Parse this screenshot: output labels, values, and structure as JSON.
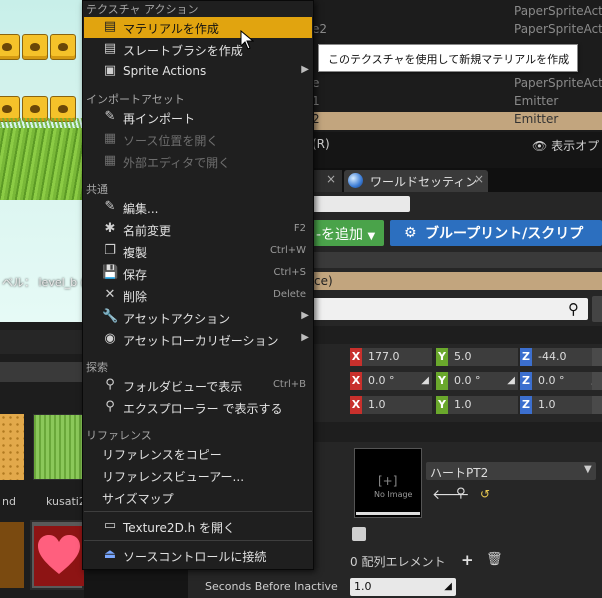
{
  "colors": {
    "menu_highlight": "#e1a40f",
    "outliner_selected": "#c2a57e",
    "add_button": "#4aa34a",
    "blueprint_button": "#2c6fbf",
    "axis_x": "#c8302c",
    "axis_y": "#6aa82c",
    "axis_z": "#3c6fcf"
  },
  "viewport": {
    "level_label": "ベル： level_b (",
    "thumbs": [
      {
        "label": "nd"
      },
      {
        "label": "kusati2"
      }
    ]
  },
  "outliner": {
    "rows": [
      {
        "name": "",
        "type": "PaperSpriteActor"
      },
      {
        "name": "e2",
        "type": "PaperSpriteActor"
      },
      {
        "name": "e",
        "type": "PaperSpriteActor"
      },
      {
        "name": "1",
        "type": "Emitter"
      },
      {
        "name": "2",
        "type": "Emitter",
        "selected": true
      }
    ],
    "status_left": "(R)",
    "view_options": "表示オプ"
  },
  "tabs": {
    "world_settings": "ワールドセッティン"
  },
  "details": {
    "add_component": "-を追加",
    "blueprint_button": "ブループリント/スクリプ",
    "tan_bar_text": "ce)",
    "location": {
      "x": "177.0",
      "y": "5.0",
      "z": "-44.0"
    },
    "rotation": {
      "x": "0.0 °",
      "y": "0.0 °",
      "z": "0.0 °"
    },
    "scale": {
      "x": "1.0",
      "y": "1.0",
      "z": "1.0"
    },
    "texture_slot_label": "No Image",
    "asset_name": "ハートPT2",
    "array_elements": "0 配列エレメント",
    "seconds_before_inactive_label": "Seconds Before Inactive",
    "seconds_before_inactive_value": "1.0"
  },
  "menu": {
    "header_texture": "テクスチャ アクション",
    "create_material": "マテリアルを作成",
    "create_slate_brush": "スレートブラシを作成",
    "sprite_actions": "Sprite Actions",
    "header_import": "インポートアセット",
    "reimport": "再インポート",
    "open_source_location": "ソース位置を開く",
    "open_in_external_editor": "外部エディタで開く",
    "header_common": "共通",
    "edit": "編集...",
    "rename": "名前変更",
    "rename_shortcut": "F2",
    "duplicate": "複製",
    "duplicate_shortcut": "Ctrl+W",
    "save": "保存",
    "save_shortcut": "Ctrl+S",
    "delete": "削除",
    "delete_shortcut": "Delete",
    "asset_actions": "アセットアクション",
    "asset_localization": "アセットローカリゼーション",
    "header_explore": "探索",
    "show_in_folder_view": "フォルダビューで表示",
    "show_in_folder_view_shortcut": "Ctrl+B",
    "show_in_explorer": "エクスプローラー で表示する",
    "header_references": "リファレンス",
    "copy_reference": "リファレンスをコピー",
    "reference_viewer": "リファレンスビューアー...",
    "size_map": "サイズマップ",
    "open_texture2d": "Texture2D.h を開く",
    "connect_source_control": "ソースコントロールに接続"
  },
  "tooltip": "このテクスチャを使用して新規マテリアルを作成"
}
